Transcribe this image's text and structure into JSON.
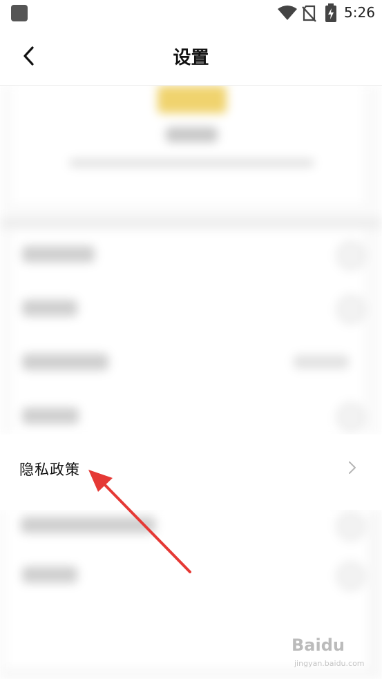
{
  "status_bar": {
    "time": "5:26",
    "icons": [
      "app-notification-icon",
      "wifi-icon",
      "no-sim-icon",
      "battery-charging-icon"
    ]
  },
  "nav": {
    "back_icon": "chevron-left-icon",
    "title": "设置"
  },
  "privacy": {
    "label": "隐私政策",
    "icon": "chevron-right-icon"
  },
  "annotation": {
    "color": "#e53935",
    "icon": "red-arrow"
  },
  "watermark": {
    "text": "Baidu",
    "sub": "jingyan.baidu.com"
  },
  "colors": {
    "accent_yellow": "#f5d86b",
    "divider": "#eeeeee",
    "chevron": "#b5b5b5"
  }
}
